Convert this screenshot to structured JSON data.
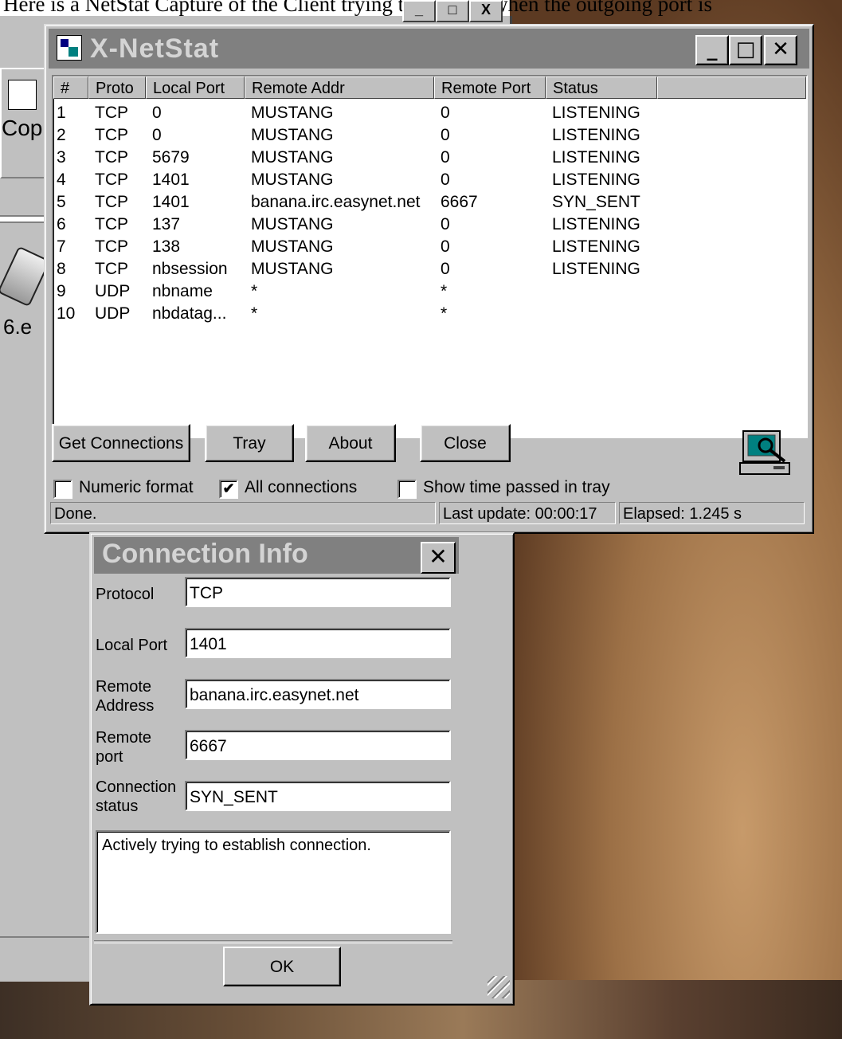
{
  "caption": "Here is a NetStat Capture of the Client trying to connect when the outgoing port is",
  "background": {
    "copy_label": "Cop",
    "exe_label": "6.e",
    "top_buttons": [
      "_",
      "□",
      "X"
    ]
  },
  "netstat": {
    "title": "X-NetStat",
    "window_buttons": {
      "minimize": "_",
      "maximize": "□",
      "close": "✕"
    },
    "columns": [
      "#",
      "Proto",
      "Local Port",
      "Remote Addr",
      "Remote Port",
      "Status",
      ""
    ],
    "rows": [
      {
        "n": "1",
        "proto": "TCP",
        "local": "0",
        "remote": "MUSTANG",
        "rport": "0",
        "status": "LISTENING"
      },
      {
        "n": "2",
        "proto": "TCP",
        "local": "0",
        "remote": "MUSTANG",
        "rport": "0",
        "status": "LISTENING"
      },
      {
        "n": "3",
        "proto": "TCP",
        "local": "5679",
        "remote": "MUSTANG",
        "rport": "0",
        "status": "LISTENING"
      },
      {
        "n": "4",
        "proto": "TCP",
        "local": "1401",
        "remote": "MUSTANG",
        "rport": "0",
        "status": "LISTENING"
      },
      {
        "n": "5",
        "proto": "TCP",
        "local": "1401",
        "remote": "banana.irc.easynet.net",
        "rport": "6667",
        "status": "SYN_SENT"
      },
      {
        "n": "6",
        "proto": "TCP",
        "local": "137",
        "remote": "MUSTANG",
        "rport": "0",
        "status": "LISTENING"
      },
      {
        "n": "7",
        "proto": "TCP",
        "local": "138",
        "remote": "MUSTANG",
        "rport": "0",
        "status": "LISTENING"
      },
      {
        "n": "8",
        "proto": "TCP",
        "local": "nbsession",
        "remote": "MUSTANG",
        "rport": "0",
        "status": "LISTENING"
      },
      {
        "n": "9",
        "proto": "UDP",
        "local": "nbname",
        "remote": "*",
        "rport": "*",
        "status": ""
      },
      {
        "n": "10",
        "proto": "UDP",
        "local": "nbdatag...",
        "remote": "*",
        "rport": "*",
        "status": ""
      }
    ],
    "buttons": {
      "get_connections": "Get Connections",
      "tray": "Tray",
      "about": "About",
      "close": "Close"
    },
    "options": {
      "numeric_format": {
        "label": "Numeric format",
        "checked": false
      },
      "all_connections": {
        "label": "All connections",
        "checked": true
      },
      "show_time": {
        "label": "Show time passed in tray",
        "checked": false
      }
    },
    "status": {
      "done": "Done.",
      "last_update": "Last update: 00:00:17",
      "elapsed": "Elapsed: 1.245 s"
    }
  },
  "conn_info": {
    "title": "Connection Info",
    "close": "✕",
    "labels": {
      "protocol": "Protocol",
      "local_port": "Local Port",
      "remote_address": "Remote\nAddress",
      "remote_port": "Remote\nport",
      "connection_status": "Connection\nstatus"
    },
    "values": {
      "protocol": "TCP",
      "local_port": "1401",
      "remote_address": "banana.irc.easynet.net",
      "remote_port": "6667",
      "connection_status": "SYN_SENT"
    },
    "description": "Actively trying to establish connection.",
    "ok": "OK"
  }
}
